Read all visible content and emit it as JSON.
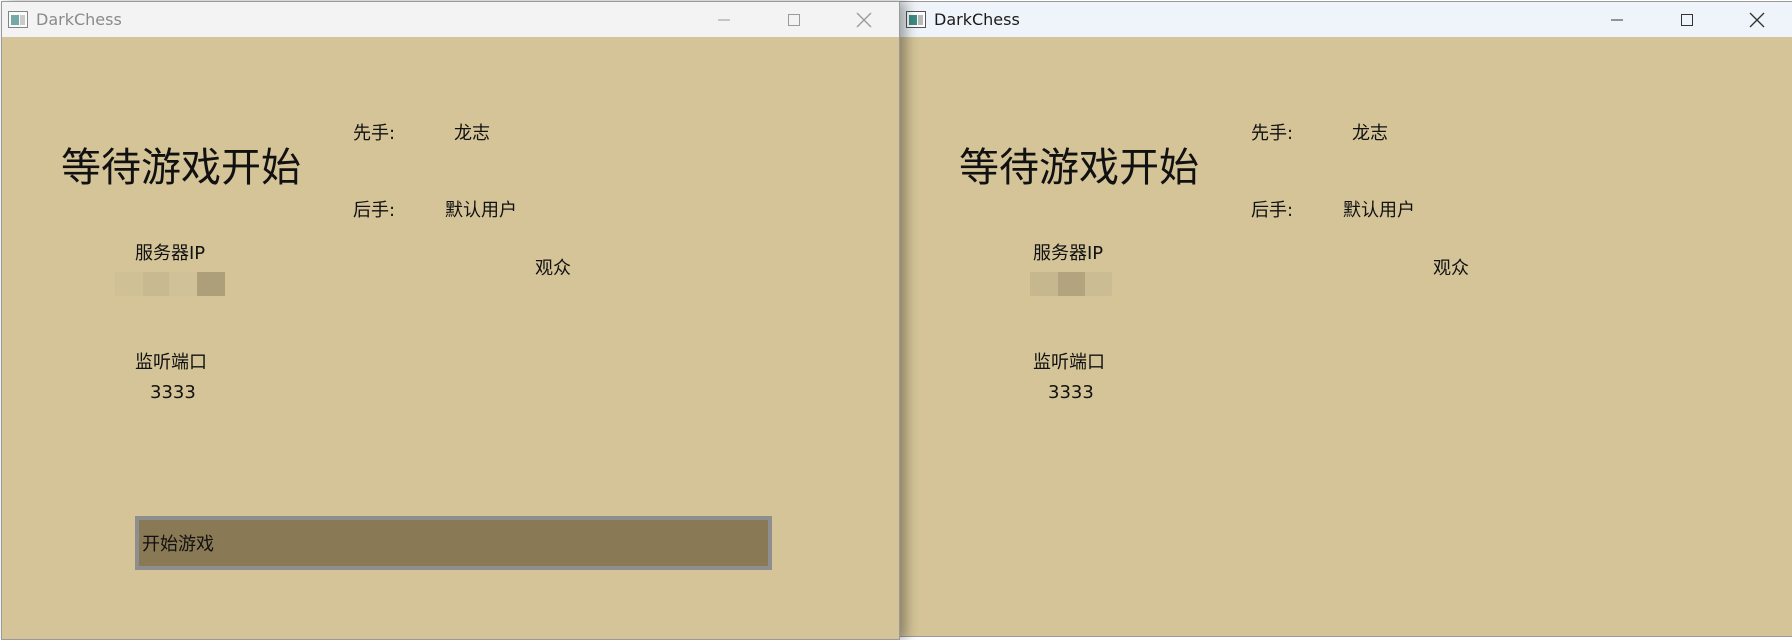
{
  "colors": {
    "window_bg": "#d4c498",
    "button_bg": "#8a7955",
    "button_border": "#8e8e8e"
  },
  "left_window": {
    "title": "DarkChess",
    "status": "等待游戏开始",
    "first_player_label": "先手:",
    "first_player_value": "龙志",
    "second_player_label": "后手:",
    "second_player_value": "默认用户",
    "audience_label": "观众",
    "server_ip_label": "服务器IP",
    "listen_port_label": "监听端口",
    "listen_port_value": "3333",
    "start_button_label": "开始游戏"
  },
  "right_window": {
    "title": "DarkChess",
    "status": "等待游戏开始",
    "first_player_label": "先手:",
    "first_player_value": "龙志",
    "second_player_label": "后手:",
    "second_player_value": "默认用户",
    "audience_label": "观众",
    "server_ip_label": "服务器IP",
    "listen_port_label": "监听端口",
    "listen_port_value": "3333"
  },
  "icons": {
    "app": "app-window-icon",
    "minimize": "minimize-icon",
    "maximize": "maximize-icon",
    "close": "close-icon"
  }
}
